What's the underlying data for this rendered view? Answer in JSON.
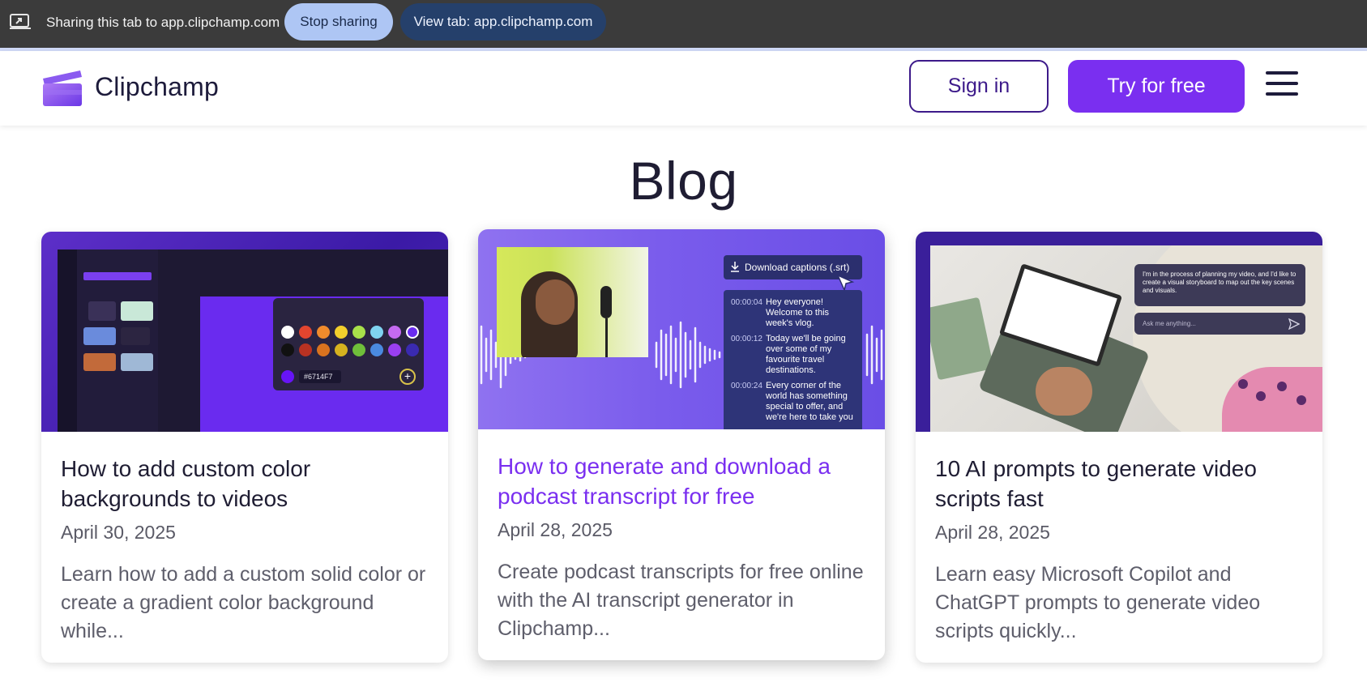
{
  "share_bar": {
    "text": "Sharing this tab to app.clipchamp.com",
    "stop_label": "Stop sharing",
    "view_label": "View tab: app.clipchamp.com"
  },
  "header": {
    "brand": "Clipchamp",
    "signin_label": "Sign in",
    "try_label": "Try for free"
  },
  "page": {
    "title": "Blog"
  },
  "cards": [
    {
      "title": "How to add custom color backgrounds to videos",
      "date": "April 30, 2025",
      "excerpt": "Learn how to add a custom solid color or create a gradient color background while...",
      "image": {
        "hex_value": "#6714F7"
      }
    },
    {
      "title": "How to generate and download a podcast transcript for free",
      "date": "April 28, 2025",
      "excerpt": "Create podcast transcripts for free online with the AI transcript generator in Clipchamp...",
      "image": {
        "download_label": "Download captions (.srt)",
        "captions": [
          {
            "time": "00:00:04",
            "text": "Hey everyone! Welcome to this week's vlog."
          },
          {
            "time": "00:00:12",
            "text": "Today we'll be going over some of my favourite travel destinations."
          },
          {
            "time": "00:00:24",
            "text": "Every corner of the world has something special to offer, and we're here to take you"
          }
        ]
      }
    },
    {
      "title": "10 AI prompts to generate video scripts fast",
      "date": "April 28, 2025",
      "excerpt": "Learn easy Microsoft Copilot and ChatGPT prompts to generate video scripts quickly...",
      "image": {
        "chat_message": "I'm in the process of planning my video, and I'd like to create a visual storyboard to map out the key scenes and visuals.",
        "ask_placeholder": "Ask me anything..."
      }
    }
  ],
  "colors": {
    "accent": "#7a2ff0",
    "share_bar": "#3b3b3b",
    "stop_button": "#aec6f4",
    "view_button": "#25406b"
  }
}
